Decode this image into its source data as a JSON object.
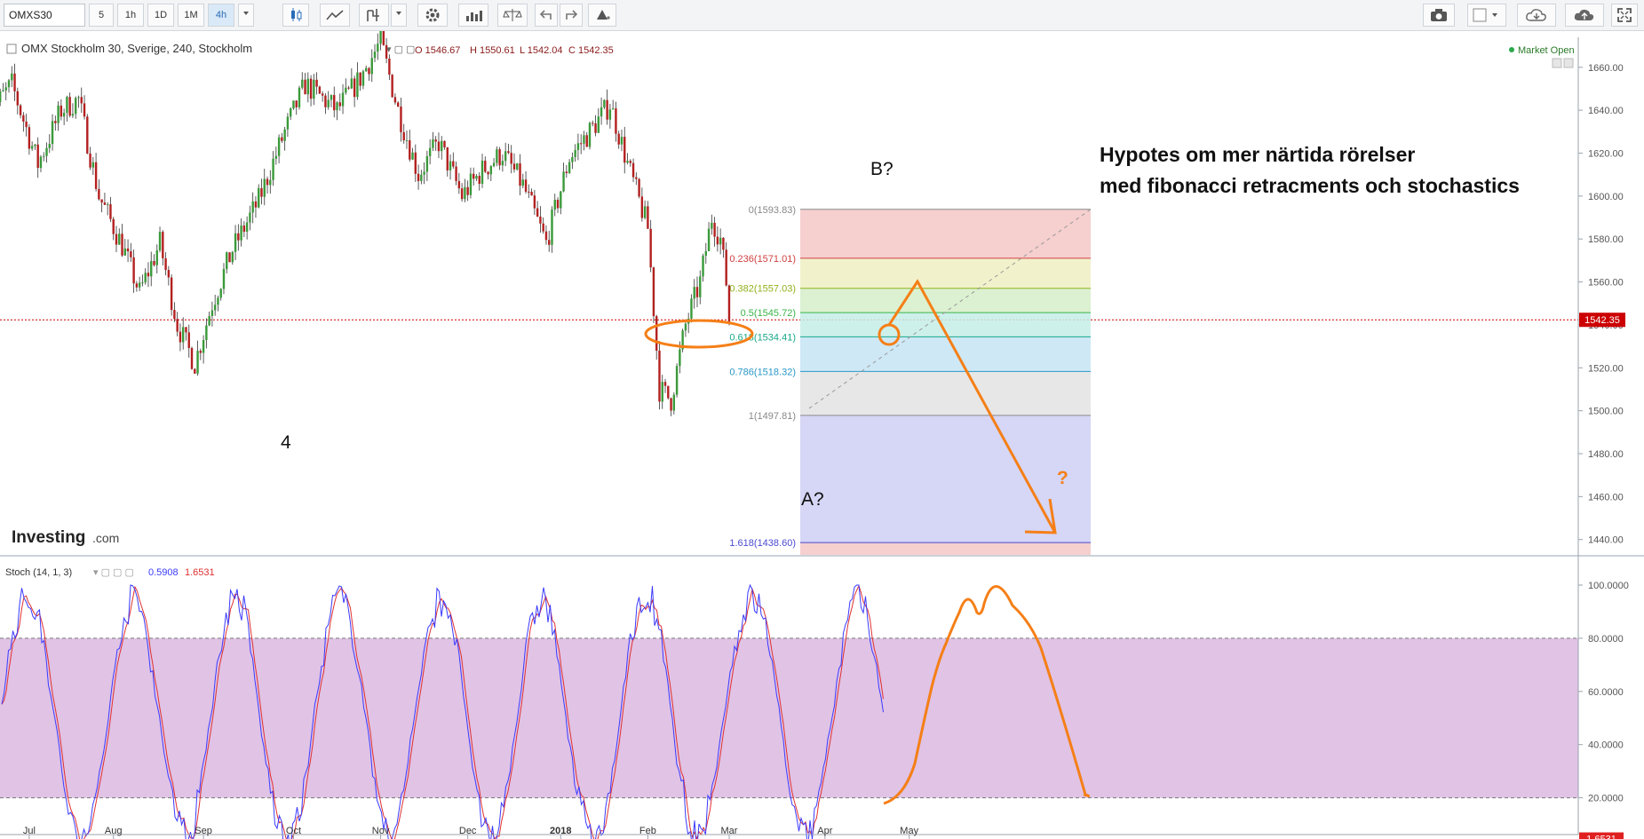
{
  "toolbar": {
    "symbol": "OMXS30",
    "intervals": [
      "5",
      "1h",
      "1D",
      "1M",
      "4h"
    ],
    "active_interval": "4h",
    "icons": [
      "dropdown-icon",
      "candlestick-icon",
      "line-chart-icon",
      "indicator-icon",
      "dropdown-icon",
      "settings-icon",
      "bar-chart-icon",
      "compare-icon",
      "undo-icon",
      "redo-icon",
      "alert-icon",
      "camera-icon",
      "color-square-icon",
      "dropdown-icon",
      "cloud-download-icon",
      "cloud-upload-icon",
      "fullscreen-icon"
    ]
  },
  "legend": {
    "title": "OMX Stockholm 30, Sverige, 240, Stockholm",
    "ohlc_o": "O 1546.67",
    "ohlc_h": "H 1550.61",
    "ohlc_l": "L 1542.04",
    "ohlc_c": "C 1542.35",
    "market_status": "Market Open"
  },
  "watermark": {
    "brand": "Investing",
    "suffix": ".com"
  },
  "annotations": {
    "heading_line1": "Hypotes om mer närtida rörelser",
    "heading_line2": "med fibonacci retracments och stochastics",
    "wave_4": "4",
    "wave_a": "A?",
    "wave_b": "B?",
    "question": "?"
  },
  "oscillator": {
    "label": "Stoch (14, 1, 3)",
    "k_value": "0.5908",
    "d_value": "1.6531"
  },
  "colors": {
    "up_candle": "#3a9a3a",
    "down_candle": "#b32020",
    "k_line": "#3a3aff",
    "d_line": "#e03030",
    "annotation": "#f57f17",
    "price_line": "#cc0000",
    "stoch_band": "#d8b4df"
  },
  "chart_data": [
    {
      "type": "candlestick",
      "title": "OMX Stockholm 30, Sverige, 240, Stockholm",
      "x_tick_labels": [
        "Jul",
        "Aug",
        "Sep",
        "Oct",
        "Nov",
        "Dec",
        "2018",
        "Feb",
        "Mar",
        "Apr",
        "May"
      ],
      "y_tick_labels": [
        "1660.00",
        "1640.00",
        "1620.00",
        "1600.00",
        "1580.00",
        "1560.00",
        "1540.00",
        "1520.00",
        "1500.00",
        "1480.00",
        "1460.00",
        "1440.00"
      ],
      "ylim": [
        1432,
        1668
      ],
      "last_price": "1542.35",
      "close_path": [
        {
          "x": "2017-06-19",
          "y": 1638
        },
        {
          "x": "2017-06-27",
          "y": 1652
        },
        {
          "x": "2017-07-06",
          "y": 1615
        },
        {
          "x": "2017-07-14",
          "y": 1640
        },
        {
          "x": "2017-07-20",
          "y": 1645
        },
        {
          "x": "2017-07-27",
          "y": 1600
        },
        {
          "x": "2017-08-04",
          "y": 1577
        },
        {
          "x": "2017-08-10",
          "y": 1555
        },
        {
          "x": "2017-08-17",
          "y": 1578
        },
        {
          "x": "2017-08-23",
          "y": 1540
        },
        {
          "x": "2017-08-29",
          "y": 1522
        },
        {
          "x": "2017-09-04",
          "y": 1550
        },
        {
          "x": "2017-09-11",
          "y": 1575
        },
        {
          "x": "2017-09-20",
          "y": 1598
        },
        {
          "x": "2017-09-29",
          "y": 1630
        },
        {
          "x": "2017-10-06",
          "y": 1652
        },
        {
          "x": "2017-10-17",
          "y": 1640
        },
        {
          "x": "2017-10-25",
          "y": 1655
        },
        {
          "x": "2017-11-01",
          "y": 1672
        },
        {
          "x": "2017-11-07",
          "y": 1640
        },
        {
          "x": "2017-11-14",
          "y": 1610
        },
        {
          "x": "2017-11-21",
          "y": 1625
        },
        {
          "x": "2017-11-29",
          "y": 1600
        },
        {
          "x": "2017-12-06",
          "y": 1612
        },
        {
          "x": "2017-12-13",
          "y": 1620
        },
        {
          "x": "2017-12-20",
          "y": 1605
        },
        {
          "x": "2017-12-28",
          "y": 1578
        },
        {
          "x": "2018-01-05",
          "y": 1618
        },
        {
          "x": "2018-01-12",
          "y": 1630
        },
        {
          "x": "2018-01-19",
          "y": 1643
        },
        {
          "x": "2018-01-25",
          "y": 1615
        },
        {
          "x": "2018-02-01",
          "y": 1585
        },
        {
          "x": "2018-02-05",
          "y": 1510
        },
        {
          "x": "2018-02-09",
          "y": 1505
        },
        {
          "x": "2018-02-14",
          "y": 1540
        },
        {
          "x": "2018-02-19",
          "y": 1560
        },
        {
          "x": "2018-02-23",
          "y": 1590
        },
        {
          "x": "2018-02-26",
          "y": 1580
        },
        {
          "x": "2018-02-28",
          "y": 1560
        },
        {
          "x": "2018-03-01",
          "y": 1542.35
        }
      ],
      "fibonacci_retracement": [
        {
          "ratio": "0",
          "price": "1593.83",
          "label": "0(1593.83)",
          "color": "#888888"
        },
        {
          "ratio": "0.236",
          "price": "1571.01",
          "label": "0.236(1571.01)",
          "color": "#d04040"
        },
        {
          "ratio": "0.382",
          "price": "1557.03",
          "label": "0.382(1557.03)",
          "color": "#8fb21c"
        },
        {
          "ratio": "0.5",
          "price": "1545.72",
          "label": "0.5(1545.72)",
          "color": "#3ab54a"
        },
        {
          "ratio": "0.618",
          "price": "1534.41",
          "label": "0.618(1534.41)",
          "color": "#18a88a"
        },
        {
          "ratio": "0.786",
          "price": "1518.32",
          "label": "0.786(1518.32)",
          "color": "#2a98c8"
        },
        {
          "ratio": "1",
          "price": "1497.81",
          "label": "1(1497.81)",
          "color": "#888888"
        },
        {
          "ratio": "1.618",
          "price": "1438.60",
          "label": "1.618(1438.60)",
          "color": "#4a4ad0"
        }
      ]
    },
    {
      "type": "line",
      "title": "Stoch (14, 1, 3)",
      "y_tick_labels": [
        "100.0000",
        "80.0000",
        "60.0000",
        "40.0000",
        "20.0000"
      ],
      "ylim": [
        -2,
        104
      ],
      "overbought": 80,
      "oversold": 20,
      "series": [
        {
          "name": "%K",
          "value_label": "0.5908"
        },
        {
          "name": "%D",
          "value_label": "1.6531"
        }
      ]
    }
  ]
}
